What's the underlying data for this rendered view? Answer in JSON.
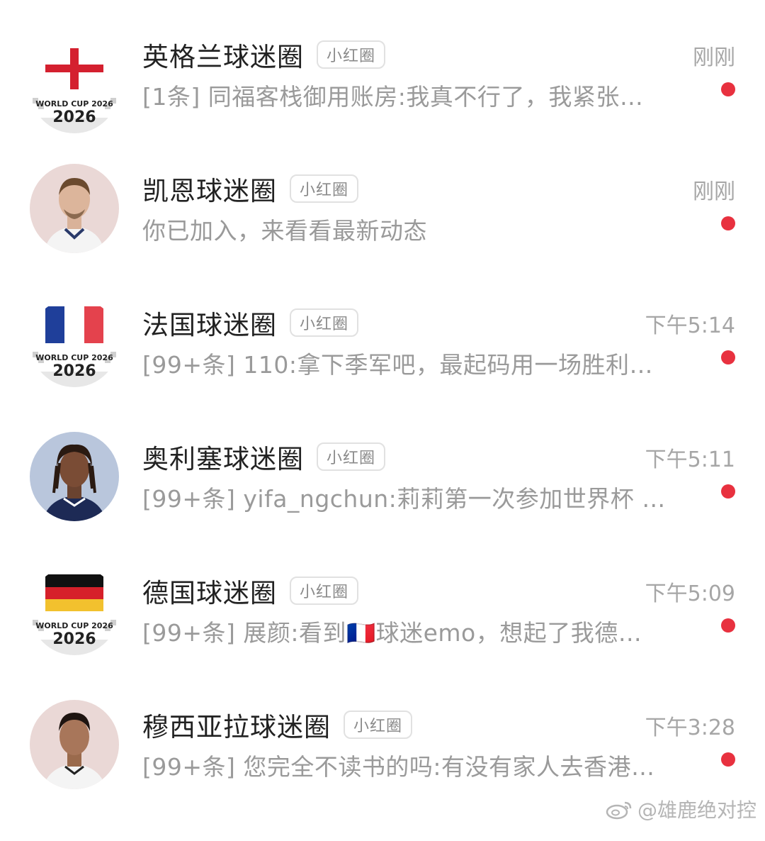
{
  "conversations": [
    {
      "title": "英格兰球迷圈",
      "badge": "小红圈",
      "time": "刚刚",
      "preview": "[1条] 同福客栈御用账房:我真不行了，我紧张…",
      "avatar": "england-flag-worldcup-2026",
      "avatar_text": "WORLD CUP 2026",
      "unread": true
    },
    {
      "title": "凯恩球迷圈",
      "badge": "小红圈",
      "time": "刚刚",
      "preview": "你已加入，来看看最新动态",
      "avatar": "player-photo",
      "unread": true
    },
    {
      "title": "法国球迷圈",
      "badge": "小红圈",
      "time": "下午5:14",
      "preview": "[99+条] 110:拿下季军吧，最起码用一场胜利…",
      "avatar": "france-flag-worldcup-2026",
      "avatar_text": "WORLD CUP 2026",
      "unread": true
    },
    {
      "title": "奥利塞球迷圈",
      "badge": "小红圈",
      "time": "下午5:11",
      "preview": "[99+条] yifa_ngchun:莉莉第一次参加世界杯 …",
      "avatar": "player-photo",
      "unread": true
    },
    {
      "title": "德国球迷圈",
      "badge": "小红圈",
      "time": "下午5:09",
      "preview": "[99+条] 展颜:看到🇫🇷球迷emo，想起了我德…",
      "avatar": "germany-flag-worldcup-2026",
      "avatar_text": "WORLD CUP 2026",
      "unread": true
    },
    {
      "title": "穆西亚拉球迷圈",
      "badge": "小红圈",
      "time": "下午3:28",
      "preview": "[99+条] 您完全不读书的吗:有没有家人去香港…",
      "avatar": "player-photo",
      "unread": true
    }
  ],
  "watermark": "@雄鹿绝对控",
  "colors": {
    "unread_dot": "#e8313f",
    "title": "#222222",
    "preview": "#9a9a9a",
    "time": "#a6a6a6"
  }
}
